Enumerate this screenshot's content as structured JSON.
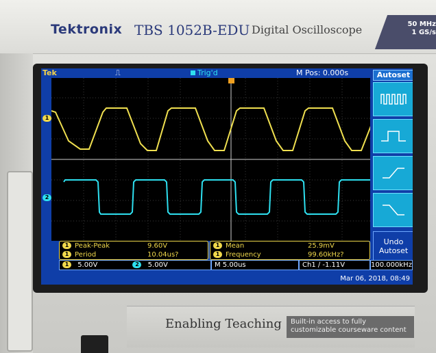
{
  "device": {
    "brand": "Tektronix",
    "model": "TBS 1052B-EDU",
    "description": "Digital Oscilloscope",
    "spec_line1": "50 MHz",
    "spec_line2": "1 GS/s",
    "panel_text": "Enabling Teaching",
    "panel_sub": "Built-in access to fully customizable courseware content"
  },
  "header": {
    "logo": "Tek",
    "trigger_state": "Trig'd",
    "m_pos": "M Pos: 0.000s"
  },
  "menu": {
    "title": "Autoset",
    "buttons": [
      {
        "name": "autoset-multi-cycle",
        "icon": "multi-cycle-icon"
      },
      {
        "name": "autoset-single-cycle",
        "icon": "single-cycle-icon"
      },
      {
        "name": "autoset-rising-edge",
        "icon": "rising-edge-icon"
      },
      {
        "name": "autoset-falling-edge",
        "icon": "falling-edge-icon"
      }
    ],
    "undo_line1": "Undo",
    "undo_line2": "Autoset"
  },
  "measurements": {
    "left": [
      {
        "ch": "1",
        "label": "Peak-Peak",
        "value": "9.60V"
      },
      {
        "ch": "1",
        "label": "Period",
        "value": "10.04us?"
      }
    ],
    "right": [
      {
        "ch": "1",
        "label": "Mean",
        "value": "25.9mV"
      },
      {
        "ch": "1",
        "label": "Frequency",
        "value": "99.60kHz?"
      }
    ]
  },
  "status": {
    "ch1_badge": "1",
    "ch1_scale": "5.00V",
    "ch2_badge": "2",
    "ch2_scale": "5.00V",
    "timebase": "M 5.00us",
    "trigger": "Ch1 ∕ -1.11V",
    "trigger_freq": "100.000kHz",
    "datetime": "Mar 06, 2018, 08:49"
  },
  "markers": {
    "ch1": "1",
    "ch2": "2"
  },
  "colors": {
    "ch1": "#f0e050",
    "ch2": "#2ee0f0",
    "screen_bg": "#0f3ea8",
    "menu_btn": "#17a9d6"
  }
}
